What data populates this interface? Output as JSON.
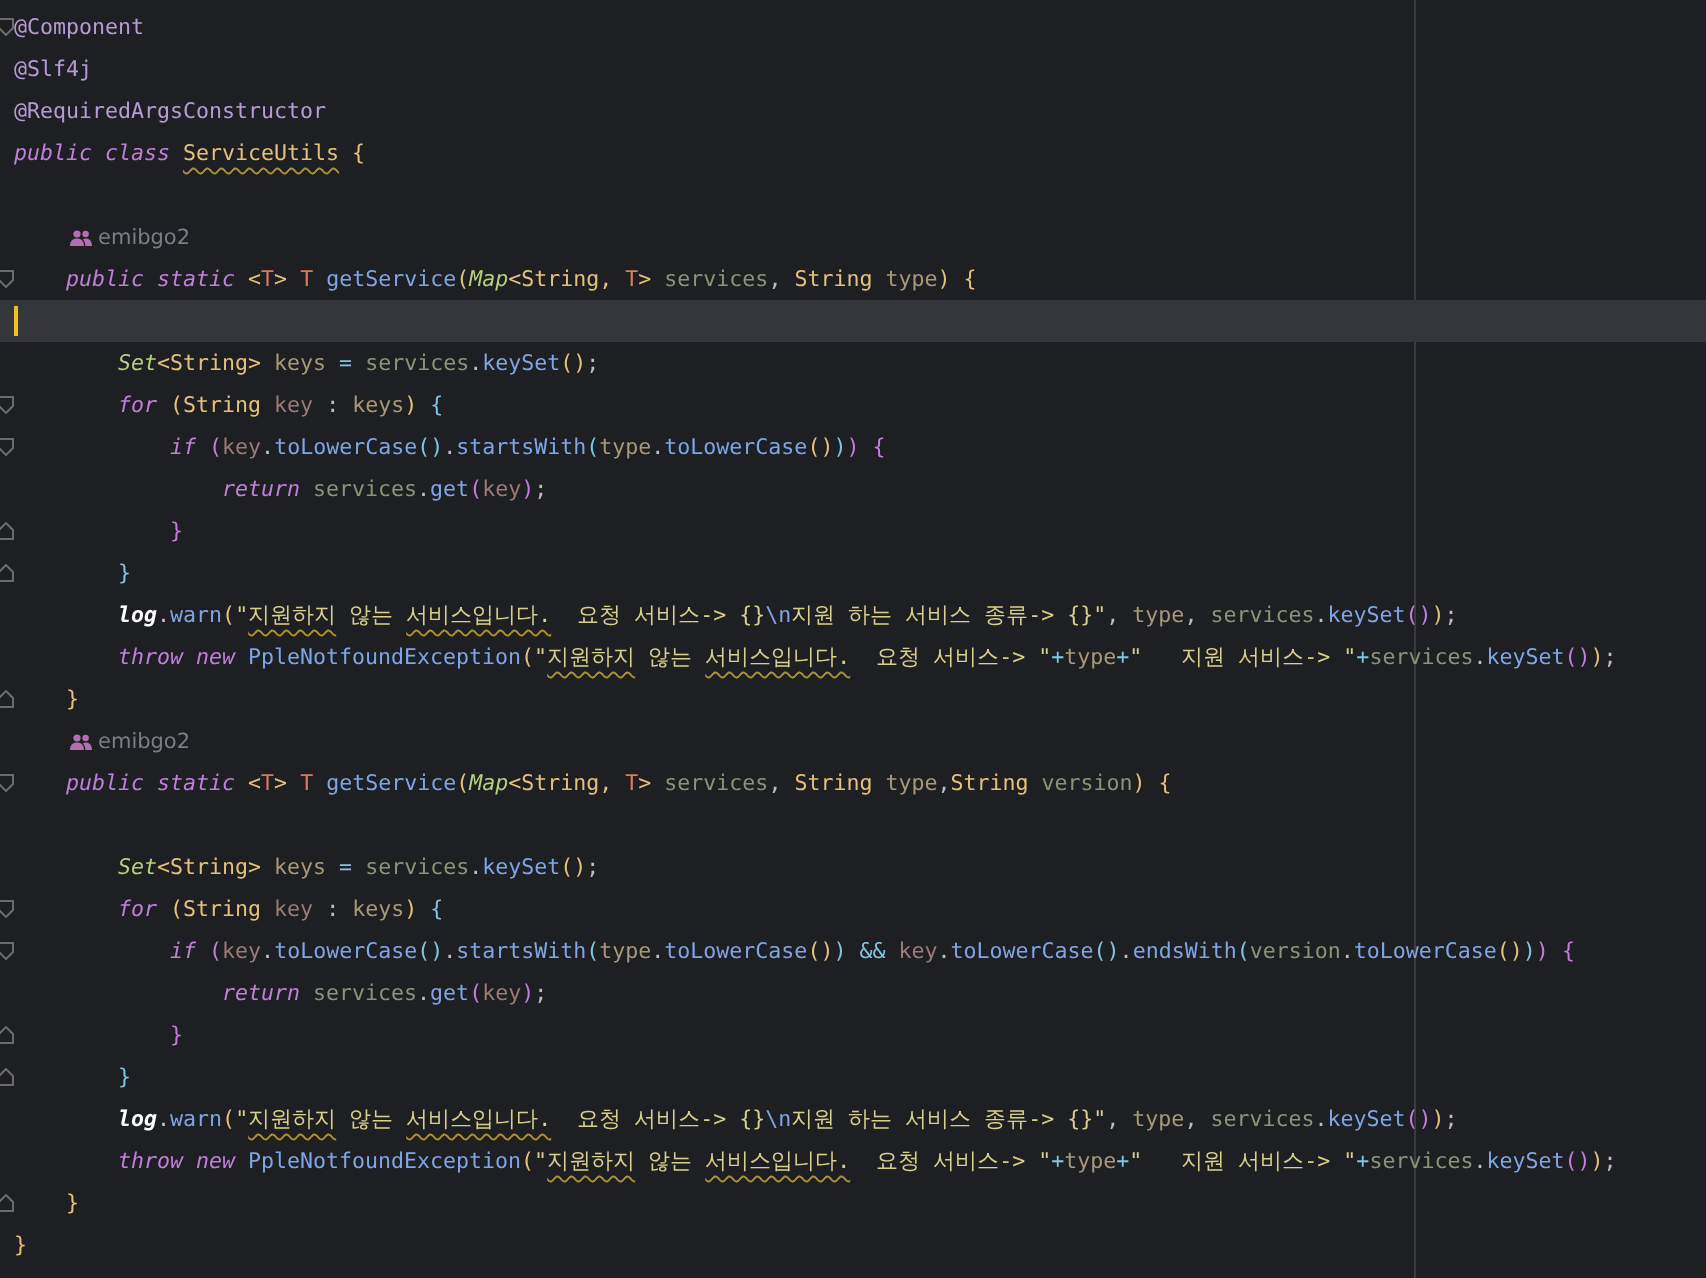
{
  "editor": {
    "lines": [
      {
        "kind": "code",
        "current": false,
        "fold_start": true,
        "fold_end": false,
        "tokens": [
          {
            "kind": "ann",
            "text": "@Component"
          }
        ]
      },
      {
        "kind": "code",
        "current": false,
        "fold_start": false,
        "fold_end": false,
        "tokens": [
          {
            "kind": "ann",
            "text": "@Slf4j"
          }
        ]
      },
      {
        "kind": "code",
        "current": false,
        "fold_start": false,
        "fold_end": false,
        "tokens": [
          {
            "kind": "ann",
            "text": "@RequiredArgsConstructor"
          }
        ]
      },
      {
        "kind": "code",
        "current": false,
        "fold_start": false,
        "fold_end": false,
        "tokens": [
          {
            "kind": "kw",
            "text": "public class "
          },
          {
            "kind": "classwarn",
            "text": "ServiceUtils"
          },
          {
            "kind": "type",
            "text": " {"
          }
        ]
      },
      {
        "kind": "blank",
        "current": false,
        "fold_start": false,
        "fold_end": false
      },
      {
        "kind": "author",
        "current": false,
        "fold_start": false,
        "fold_end": false,
        "author": "emibgo2"
      },
      {
        "kind": "code",
        "current": false,
        "fold_start": true,
        "fold_end": false,
        "tokens": [
          {
            "kind": "kw",
            "text": "    public static "
          },
          {
            "kind": "type",
            "text": "<"
          },
          {
            "kind": "tp",
            "text": "T"
          },
          {
            "kind": "type",
            "text": "> "
          },
          {
            "kind": "tp",
            "text": "T "
          },
          {
            "kind": "method",
            "text": "getService"
          },
          {
            "kind": "p1",
            "text": "("
          },
          {
            "kind": "iface",
            "text": "Map"
          },
          {
            "kind": "type",
            "text": "<String, "
          },
          {
            "kind": "tp",
            "text": "T"
          },
          {
            "kind": "type",
            "text": "> "
          },
          {
            "kind": "param",
            "text": "services"
          },
          {
            "kind": "punct",
            "text": ", "
          },
          {
            "kind": "type",
            "text": "String "
          },
          {
            "kind": "local",
            "text": "type"
          },
          {
            "kind": "p1",
            "text": ")"
          },
          {
            "kind": "type",
            "text": " {"
          }
        ]
      },
      {
        "kind": "blank",
        "current": true,
        "fold_start": false,
        "fold_end": false
      },
      {
        "kind": "code",
        "current": false,
        "fold_start": false,
        "fold_end": false,
        "tokens": [
          {
            "kind": "iface",
            "text": "        Set"
          },
          {
            "kind": "type",
            "text": "<String> "
          },
          {
            "kind": "local",
            "text": "keys "
          },
          {
            "kind": "op",
            "text": "= "
          },
          {
            "kind": "param",
            "text": "services"
          },
          {
            "kind": "punct",
            "text": "."
          },
          {
            "kind": "method",
            "text": "keySet"
          },
          {
            "kind": "p1",
            "text": "()"
          },
          {
            "kind": "punct",
            "text": ";"
          }
        ]
      },
      {
        "kind": "code",
        "current": false,
        "fold_start": true,
        "fold_end": false,
        "tokens": [
          {
            "kind": "kw",
            "text": "        for "
          },
          {
            "kind": "p1",
            "text": "("
          },
          {
            "kind": "type",
            "text": "String "
          },
          {
            "kind": "var",
            "text": "key "
          },
          {
            "kind": "punct",
            "text": ": "
          },
          {
            "kind": "local",
            "text": "keys"
          },
          {
            "kind": "p1",
            "text": ")"
          },
          {
            "kind": "p3",
            "text": " {"
          }
        ]
      },
      {
        "kind": "code",
        "current": false,
        "fold_start": true,
        "fold_end": false,
        "tokens": [
          {
            "kind": "kw",
            "text": "            if "
          },
          {
            "kind": "p2",
            "text": "("
          },
          {
            "kind": "var",
            "text": "key"
          },
          {
            "kind": "punct",
            "text": "."
          },
          {
            "kind": "method",
            "text": "toLowerCase"
          },
          {
            "kind": "p3",
            "text": "()"
          },
          {
            "kind": "punct",
            "text": "."
          },
          {
            "kind": "method",
            "text": "startsWith"
          },
          {
            "kind": "p3",
            "text": "("
          },
          {
            "kind": "local",
            "text": "type"
          },
          {
            "kind": "punct",
            "text": "."
          },
          {
            "kind": "method",
            "text": "toLowerCase"
          },
          {
            "kind": "p1",
            "text": "()"
          },
          {
            "kind": "p3",
            "text": ")"
          },
          {
            "kind": "p2",
            "text": ")"
          },
          {
            "kind": "p2",
            "text": " {"
          }
        ]
      },
      {
        "kind": "code",
        "current": false,
        "fold_start": false,
        "fold_end": false,
        "tokens": [
          {
            "kind": "kw",
            "text": "                return "
          },
          {
            "kind": "param",
            "text": "services"
          },
          {
            "kind": "punct",
            "text": "."
          },
          {
            "kind": "method",
            "text": "get"
          },
          {
            "kind": "p2",
            "text": "("
          },
          {
            "kind": "var",
            "text": "key"
          },
          {
            "kind": "p2",
            "text": ")"
          },
          {
            "kind": "punct",
            "text": ";"
          }
        ]
      },
      {
        "kind": "code",
        "current": false,
        "fold_start": false,
        "fold_end": true,
        "tokens": [
          {
            "kind": "p2",
            "text": "            }"
          }
        ]
      },
      {
        "kind": "code",
        "current": false,
        "fold_start": false,
        "fold_end": true,
        "tokens": [
          {
            "kind": "p3",
            "text": "        }"
          }
        ]
      },
      {
        "kind": "code",
        "current": false,
        "fold_start": false,
        "fold_end": false,
        "tokens": [
          {
            "kind": "log",
            "text": "        log"
          },
          {
            "kind": "punct",
            "text": "."
          },
          {
            "kind": "method",
            "text": "warn"
          },
          {
            "kind": "p1",
            "text": "("
          },
          {
            "kind": "str",
            "text": "\""
          },
          {
            "kind": "strwarn",
            "text": "지원하지"
          },
          {
            "kind": "str",
            "text": " 않는 "
          },
          {
            "kind": "strwarn",
            "text": "서비스입니다."
          },
          {
            "kind": "str",
            "text": "  요청 서비스-> {}"
          },
          {
            "kind": "esc",
            "text": "\\n"
          },
          {
            "kind": "str",
            "text": "지원 하는 서비스 종류-> {}\""
          },
          {
            "kind": "punct",
            "text": ", "
          },
          {
            "kind": "local",
            "text": "type"
          },
          {
            "kind": "punct",
            "text": ", "
          },
          {
            "kind": "param",
            "text": "services"
          },
          {
            "kind": "punct",
            "text": "."
          },
          {
            "kind": "method",
            "text": "keySet"
          },
          {
            "kind": "p2",
            "text": "()"
          },
          {
            "kind": "p1",
            "text": ")"
          },
          {
            "kind": "punct",
            "text": ";"
          }
        ]
      },
      {
        "kind": "code",
        "current": false,
        "fold_start": false,
        "fold_end": false,
        "tokens": [
          {
            "kind": "kw",
            "text": "        throw new "
          },
          {
            "kind": "method",
            "text": "PpleNotfoundException"
          },
          {
            "kind": "p1",
            "text": "("
          },
          {
            "kind": "str",
            "text": "\""
          },
          {
            "kind": "strwarn",
            "text": "지원하지"
          },
          {
            "kind": "str",
            "text": " 않는 "
          },
          {
            "kind": "strwarn",
            "text": "서비스입니다."
          },
          {
            "kind": "str",
            "text": "  요청 서비스-> \""
          },
          {
            "kind": "op",
            "text": "+"
          },
          {
            "kind": "local",
            "text": "type"
          },
          {
            "kind": "op",
            "text": "+"
          },
          {
            "kind": "str",
            "text": "\"   지원 서비스-> \""
          },
          {
            "kind": "op",
            "text": "+"
          },
          {
            "kind": "param",
            "text": "services"
          },
          {
            "kind": "punct",
            "text": "."
          },
          {
            "kind": "method",
            "text": "keySet"
          },
          {
            "kind": "p2",
            "text": "()"
          },
          {
            "kind": "p1",
            "text": ")"
          },
          {
            "kind": "punct",
            "text": ";"
          }
        ]
      },
      {
        "kind": "code",
        "current": false,
        "fold_start": false,
        "fold_end": true,
        "tokens": [
          {
            "kind": "type",
            "text": "    }"
          }
        ]
      },
      {
        "kind": "author",
        "current": false,
        "fold_start": false,
        "fold_end": false,
        "author": "emibgo2"
      },
      {
        "kind": "code",
        "current": false,
        "fold_start": true,
        "fold_end": false,
        "tokens": [
          {
            "kind": "kw",
            "text": "    public static "
          },
          {
            "kind": "type",
            "text": "<"
          },
          {
            "kind": "tp",
            "text": "T"
          },
          {
            "kind": "type",
            "text": "> "
          },
          {
            "kind": "tp",
            "text": "T "
          },
          {
            "kind": "method",
            "text": "getService"
          },
          {
            "kind": "p1",
            "text": "("
          },
          {
            "kind": "iface",
            "text": "Map"
          },
          {
            "kind": "type",
            "text": "<String, "
          },
          {
            "kind": "tp",
            "text": "T"
          },
          {
            "kind": "type",
            "text": "> "
          },
          {
            "kind": "param",
            "text": "services"
          },
          {
            "kind": "punct",
            "text": ", "
          },
          {
            "kind": "type",
            "text": "String "
          },
          {
            "kind": "local",
            "text": "type"
          },
          {
            "kind": "punct",
            "text": ","
          },
          {
            "kind": "type",
            "text": "String "
          },
          {
            "kind": "param",
            "text": "version"
          },
          {
            "kind": "p1",
            "text": ")"
          },
          {
            "kind": "type",
            "text": " {"
          }
        ]
      },
      {
        "kind": "blank",
        "current": false,
        "fold_start": false,
        "fold_end": false
      },
      {
        "kind": "code",
        "current": false,
        "fold_start": false,
        "fold_end": false,
        "tokens": [
          {
            "kind": "iface",
            "text": "        Set"
          },
          {
            "kind": "type",
            "text": "<String> "
          },
          {
            "kind": "local",
            "text": "keys "
          },
          {
            "kind": "op",
            "text": "= "
          },
          {
            "kind": "param",
            "text": "services"
          },
          {
            "kind": "punct",
            "text": "."
          },
          {
            "kind": "method",
            "text": "keySet"
          },
          {
            "kind": "p1",
            "text": "()"
          },
          {
            "kind": "punct",
            "text": ";"
          }
        ]
      },
      {
        "kind": "code",
        "current": false,
        "fold_start": true,
        "fold_end": false,
        "tokens": [
          {
            "kind": "kw",
            "text": "        for "
          },
          {
            "kind": "p1",
            "text": "("
          },
          {
            "kind": "type",
            "text": "String "
          },
          {
            "kind": "var",
            "text": "key "
          },
          {
            "kind": "punct",
            "text": ": "
          },
          {
            "kind": "local",
            "text": "keys"
          },
          {
            "kind": "p1",
            "text": ")"
          },
          {
            "kind": "p3",
            "text": " {"
          }
        ]
      },
      {
        "kind": "code",
        "current": false,
        "fold_start": true,
        "fold_end": false,
        "tokens": [
          {
            "kind": "kw",
            "text": "            if "
          },
          {
            "kind": "p2",
            "text": "("
          },
          {
            "kind": "var",
            "text": "key"
          },
          {
            "kind": "punct",
            "text": "."
          },
          {
            "kind": "method",
            "text": "toLowerCase"
          },
          {
            "kind": "p3",
            "text": "()"
          },
          {
            "kind": "punct",
            "text": "."
          },
          {
            "kind": "method",
            "text": "startsWith"
          },
          {
            "kind": "p3",
            "text": "("
          },
          {
            "kind": "local",
            "text": "type"
          },
          {
            "kind": "punct",
            "text": "."
          },
          {
            "kind": "method",
            "text": "toLowerCase"
          },
          {
            "kind": "p1",
            "text": "()"
          },
          {
            "kind": "p3",
            "text": ")"
          },
          {
            "kind": "op",
            "text": " && "
          },
          {
            "kind": "var",
            "text": "key"
          },
          {
            "kind": "punct",
            "text": "."
          },
          {
            "kind": "method",
            "text": "toLowerCase"
          },
          {
            "kind": "p3",
            "text": "()"
          },
          {
            "kind": "punct",
            "text": "."
          },
          {
            "kind": "method",
            "text": "endsWith"
          },
          {
            "kind": "p3",
            "text": "("
          },
          {
            "kind": "param",
            "text": "version"
          },
          {
            "kind": "punct",
            "text": "."
          },
          {
            "kind": "method",
            "text": "toLowerCase"
          },
          {
            "kind": "p1",
            "text": "()"
          },
          {
            "kind": "p3",
            "text": ")"
          },
          {
            "kind": "p2",
            "text": ")"
          },
          {
            "kind": "p2",
            "text": " {"
          }
        ]
      },
      {
        "kind": "code",
        "current": false,
        "fold_start": false,
        "fold_end": false,
        "tokens": [
          {
            "kind": "kw",
            "text": "                return "
          },
          {
            "kind": "param",
            "text": "services"
          },
          {
            "kind": "punct",
            "text": "."
          },
          {
            "kind": "method",
            "text": "get"
          },
          {
            "kind": "p2",
            "text": "("
          },
          {
            "kind": "var",
            "text": "key"
          },
          {
            "kind": "p2",
            "text": ")"
          },
          {
            "kind": "punct",
            "text": ";"
          }
        ]
      },
      {
        "kind": "code",
        "current": false,
        "fold_start": false,
        "fold_end": true,
        "tokens": [
          {
            "kind": "p2",
            "text": "            }"
          }
        ]
      },
      {
        "kind": "code",
        "current": false,
        "fold_start": false,
        "fold_end": true,
        "tokens": [
          {
            "kind": "p3",
            "text": "        }"
          }
        ]
      },
      {
        "kind": "code",
        "current": false,
        "fold_start": false,
        "fold_end": false,
        "tokens": [
          {
            "kind": "log",
            "text": "        log"
          },
          {
            "kind": "punct",
            "text": "."
          },
          {
            "kind": "method",
            "text": "warn"
          },
          {
            "kind": "p1",
            "text": "("
          },
          {
            "kind": "str",
            "text": "\""
          },
          {
            "kind": "strwarn",
            "text": "지원하지"
          },
          {
            "kind": "str",
            "text": " 않는 "
          },
          {
            "kind": "strwarn",
            "text": "서비스입니다."
          },
          {
            "kind": "str",
            "text": "  요청 서비스-> {}"
          },
          {
            "kind": "esc",
            "text": "\\n"
          },
          {
            "kind": "str",
            "text": "지원 하는 서비스 종류-> {}\""
          },
          {
            "kind": "punct",
            "text": ", "
          },
          {
            "kind": "local",
            "text": "type"
          },
          {
            "kind": "punct",
            "text": ", "
          },
          {
            "kind": "param",
            "text": "services"
          },
          {
            "kind": "punct",
            "text": "."
          },
          {
            "kind": "method",
            "text": "keySet"
          },
          {
            "kind": "p2",
            "text": "()"
          },
          {
            "kind": "p1",
            "text": ")"
          },
          {
            "kind": "punct",
            "text": ";"
          }
        ]
      },
      {
        "kind": "code",
        "current": false,
        "fold_start": false,
        "fold_end": false,
        "tokens": [
          {
            "kind": "kw",
            "text": "        throw new "
          },
          {
            "kind": "method",
            "text": "PpleNotfoundException"
          },
          {
            "kind": "p1",
            "text": "("
          },
          {
            "kind": "str",
            "text": "\""
          },
          {
            "kind": "strwarn",
            "text": "지원하지"
          },
          {
            "kind": "str",
            "text": " 않는 "
          },
          {
            "kind": "strwarn",
            "text": "서비스입니다."
          },
          {
            "kind": "str",
            "text": "  요청 서비스-> \""
          },
          {
            "kind": "op",
            "text": "+"
          },
          {
            "kind": "local",
            "text": "type"
          },
          {
            "kind": "op",
            "text": "+"
          },
          {
            "kind": "str",
            "text": "\"   지원 서비스-> \""
          },
          {
            "kind": "op",
            "text": "+"
          },
          {
            "kind": "param",
            "text": "services"
          },
          {
            "kind": "punct",
            "text": "."
          },
          {
            "kind": "method",
            "text": "keySet"
          },
          {
            "kind": "p2",
            "text": "()"
          },
          {
            "kind": "p1",
            "text": ")"
          },
          {
            "kind": "punct",
            "text": ";"
          }
        ]
      },
      {
        "kind": "code",
        "current": false,
        "fold_start": false,
        "fold_end": true,
        "tokens": [
          {
            "kind": "type",
            "text": "    }"
          }
        ]
      },
      {
        "kind": "code",
        "current": false,
        "fold_start": false,
        "fold_end": false,
        "tokens": [
          {
            "kind": "type",
            "text": "}"
          }
        ]
      }
    ]
  }
}
